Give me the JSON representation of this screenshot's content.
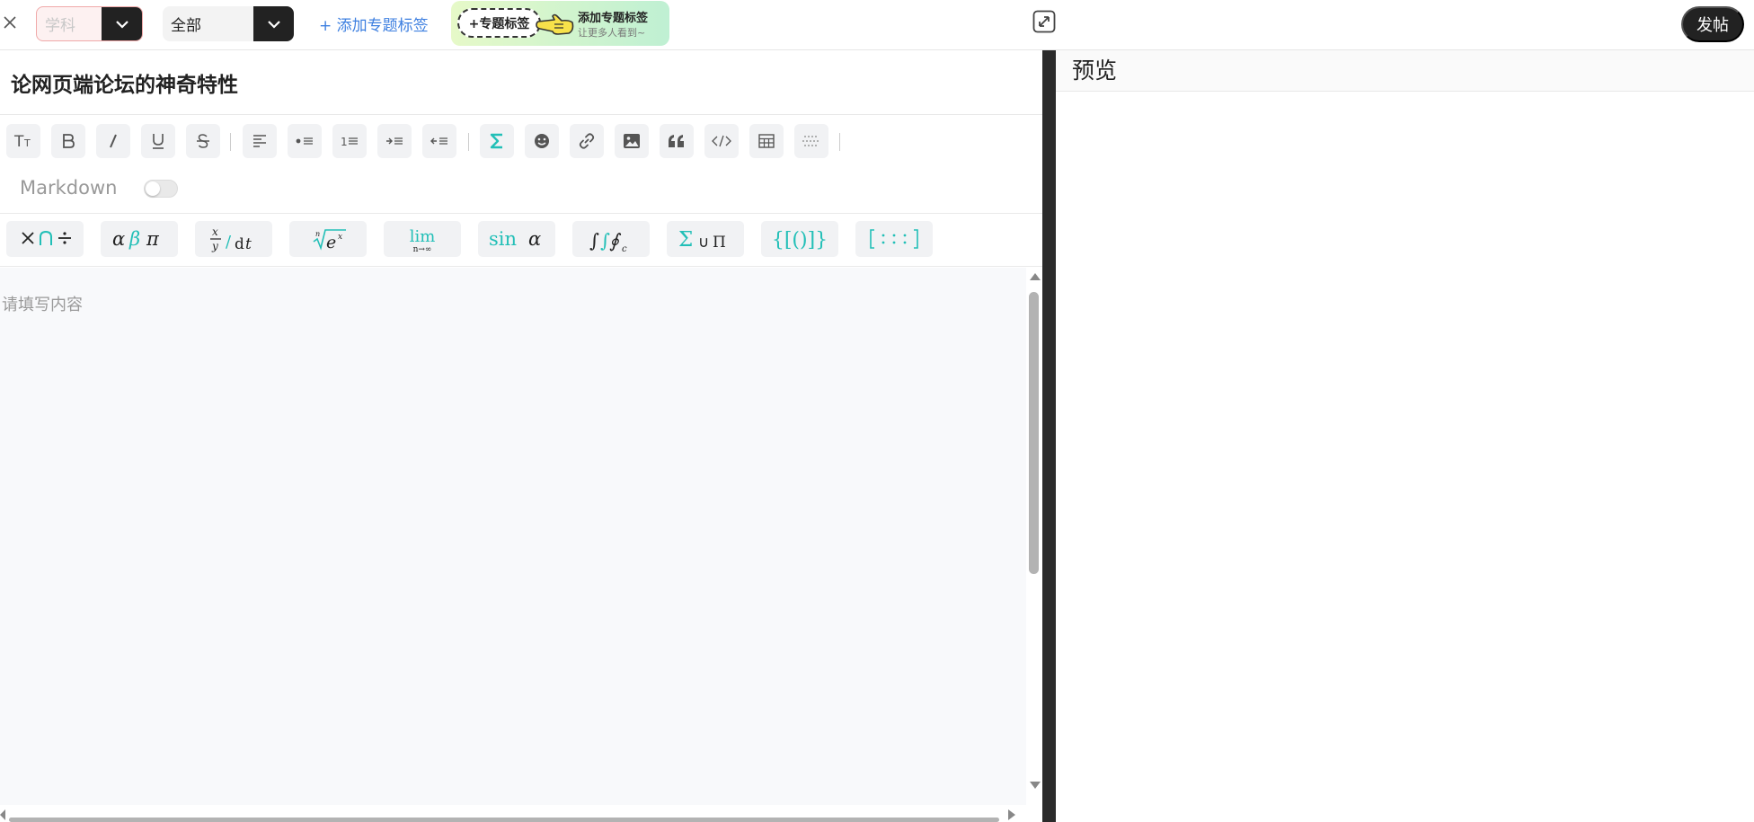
{
  "header": {
    "subject_placeholder": "学科",
    "scope_value": "全部",
    "add_topic_link": "+ 添加专题标签",
    "promo": {
      "chip_label": "+专题标签",
      "title": "添加专题标签",
      "subtitle": "让更多人看到~"
    },
    "post_label": "发帖"
  },
  "editor": {
    "title_value": "论网页端论坛的神奇特性",
    "toolbar_icons": [
      "text-size-icon",
      "bold-icon",
      "italic-icon",
      "underline-icon",
      "strikethrough-icon",
      "align-left-icon",
      "bullet-list-icon",
      "numbered-list-icon",
      "indent-icon",
      "outdent-icon",
      "formula-icon",
      "emoji-icon",
      "link-icon",
      "image-icon",
      "quote-icon",
      "code-icon",
      "table-icon",
      "horizontal-rule-icon"
    ],
    "accent_color": "#22bfb7",
    "markdown_label": "Markdown",
    "markdown_enabled": false,
    "math_groups": [
      "operators",
      "greek-letters",
      "fractions-derivatives",
      "roots-powers",
      "limits",
      "functions",
      "integrals",
      "large-operators",
      "brackets",
      "matrices"
    ],
    "content_placeholder": "请填写内容"
  },
  "preview": {
    "title": "预览"
  }
}
